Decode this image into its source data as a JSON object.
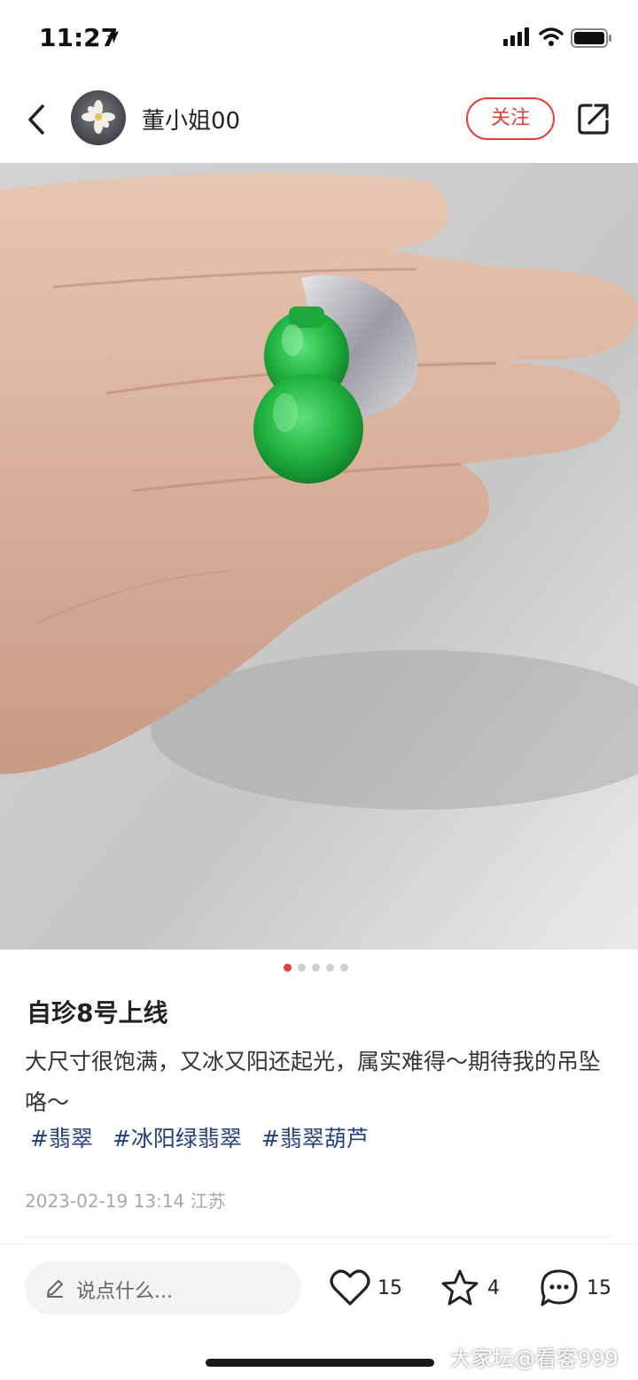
{
  "status_bar": {
    "time": "11:27",
    "icons": [
      "location-arrow-icon",
      "signal-icon",
      "wifi-icon",
      "battery-icon"
    ]
  },
  "header": {
    "back_icon": "chevron-left-icon",
    "username": "董小姐00",
    "follow_label": "关注",
    "share_icon": "share-icon"
  },
  "photo": {
    "description_icon": "jade-gourd-photo",
    "page_count": 5,
    "current_page": 1
  },
  "post": {
    "title": "自珍8号上线",
    "body": "大尺寸很饱满，又冰又阳还起光，属实难得～期待我的吊坠咯～",
    "tags": [
      "#翡翠",
      "#冰阳绿翡翠",
      "#翡翠葫芦"
    ],
    "date": "2023-02-19 13:14",
    "location": "江苏"
  },
  "bottom_bar": {
    "comment_placeholder": "说点什么...",
    "likes": "15",
    "favorites": "4",
    "comments": "15"
  },
  "watermark": "大家坛@看客999",
  "colors": {
    "accent": "#e2403a",
    "tag": "#23407a",
    "meta": "#a8a8a8"
  }
}
